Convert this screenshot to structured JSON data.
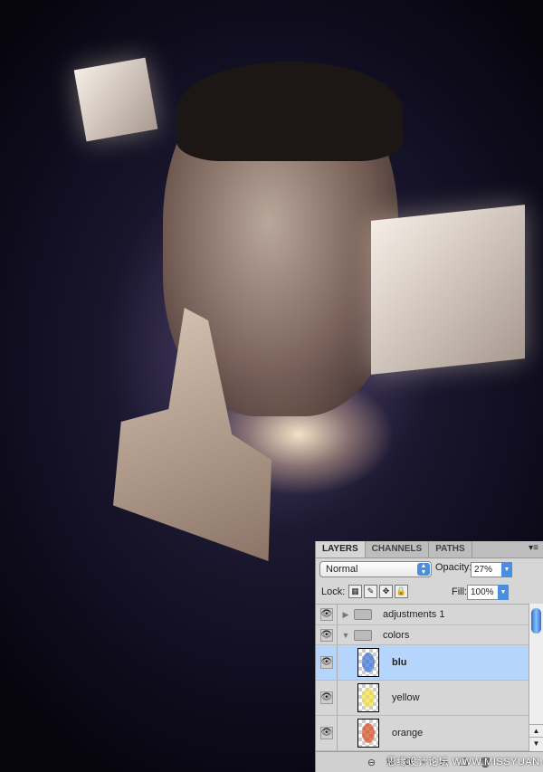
{
  "panel": {
    "tabs": [
      {
        "label": "LAYERS",
        "active": true
      },
      {
        "label": "CHANNELS",
        "active": false
      },
      {
        "label": "PATHS",
        "active": false
      }
    ],
    "blend_mode": "Normal",
    "opacity_label": "Opacity:",
    "opacity_value": "27%",
    "lock_label": "Lock:",
    "fill_label": "Fill:",
    "fill_value": "100%",
    "layers": [
      {
        "name": "adjustments 1",
        "type": "group",
        "expanded": false,
        "visible": true
      },
      {
        "name": "colors",
        "type": "group",
        "expanded": true,
        "visible": true
      },
      {
        "name": "blu",
        "type": "layer",
        "selected": true,
        "visible": true,
        "thumb_color": "#3a6fd8"
      },
      {
        "name": "yellow",
        "type": "layer",
        "visible": true,
        "thumb_color": "#f0e040"
      },
      {
        "name": "orange",
        "type": "layer",
        "visible": true,
        "thumb_color": "#d84a20"
      }
    ],
    "selected_color": "#b5d5fc",
    "footer_icons": [
      "link-icon",
      "fx-icon",
      "mask-icon",
      "adjustment-icon",
      "new-group-icon",
      "new-layer-icon",
      "trash-icon"
    ]
  },
  "watermark": "思缘设计论坛 WWW.MISSYUAN.COM"
}
